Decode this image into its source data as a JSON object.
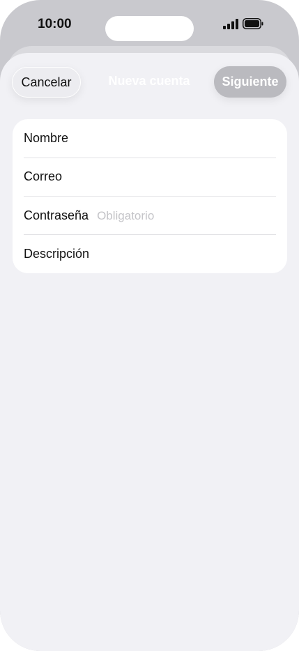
{
  "status_bar": {
    "time": "10:00",
    "icons": [
      "signal-icon",
      "battery-icon"
    ]
  },
  "nav": {
    "cancel_label": "Cancelar",
    "title": "Nueva cuenta",
    "next_label": "Siguiente"
  },
  "form": {
    "fields": [
      {
        "label": "Nombre",
        "placeholder": ""
      },
      {
        "label": "Correo",
        "placeholder": ""
      },
      {
        "label": "Contraseña",
        "placeholder": "Obligatorio"
      },
      {
        "label": "Descripción",
        "placeholder": ""
      }
    ]
  },
  "colors": {
    "sheet_background": "#f1f1f5",
    "next_button_disabled": "#bababf",
    "placeholder": "#c4c4c8"
  }
}
